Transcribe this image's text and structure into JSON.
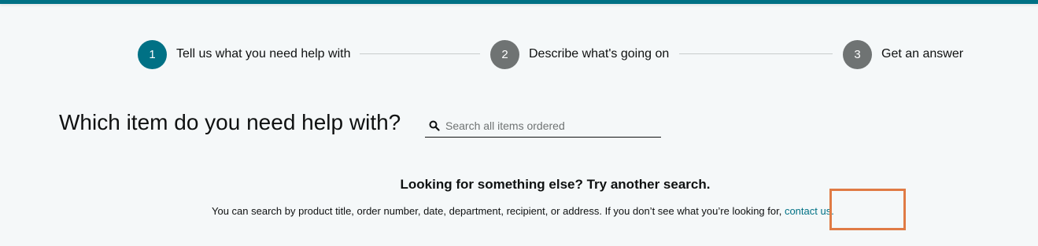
{
  "stepper": {
    "steps": [
      {
        "number": "1",
        "label": "Tell us what you need help with",
        "state": "active"
      },
      {
        "number": "2",
        "label": "Describe what's going on",
        "state": "inactive"
      },
      {
        "number": "3",
        "label": "Get an answer",
        "state": "inactive"
      }
    ]
  },
  "main": {
    "question": "Which item do you need help with?",
    "search": {
      "placeholder": "Search all items ordered",
      "value": "",
      "icon": "search-icon"
    },
    "help": {
      "heading": "Looking for something else? Try another search.",
      "text": "You can search by product title, order number, date, department, recipient, or address. If you don’t see what you’re looking for, ",
      "link": "contact us."
    }
  },
  "colors": {
    "accent": "#007185",
    "inactive_step": "#6f7373",
    "background": "#f5f8f9",
    "highlight": "#e07b45"
  }
}
